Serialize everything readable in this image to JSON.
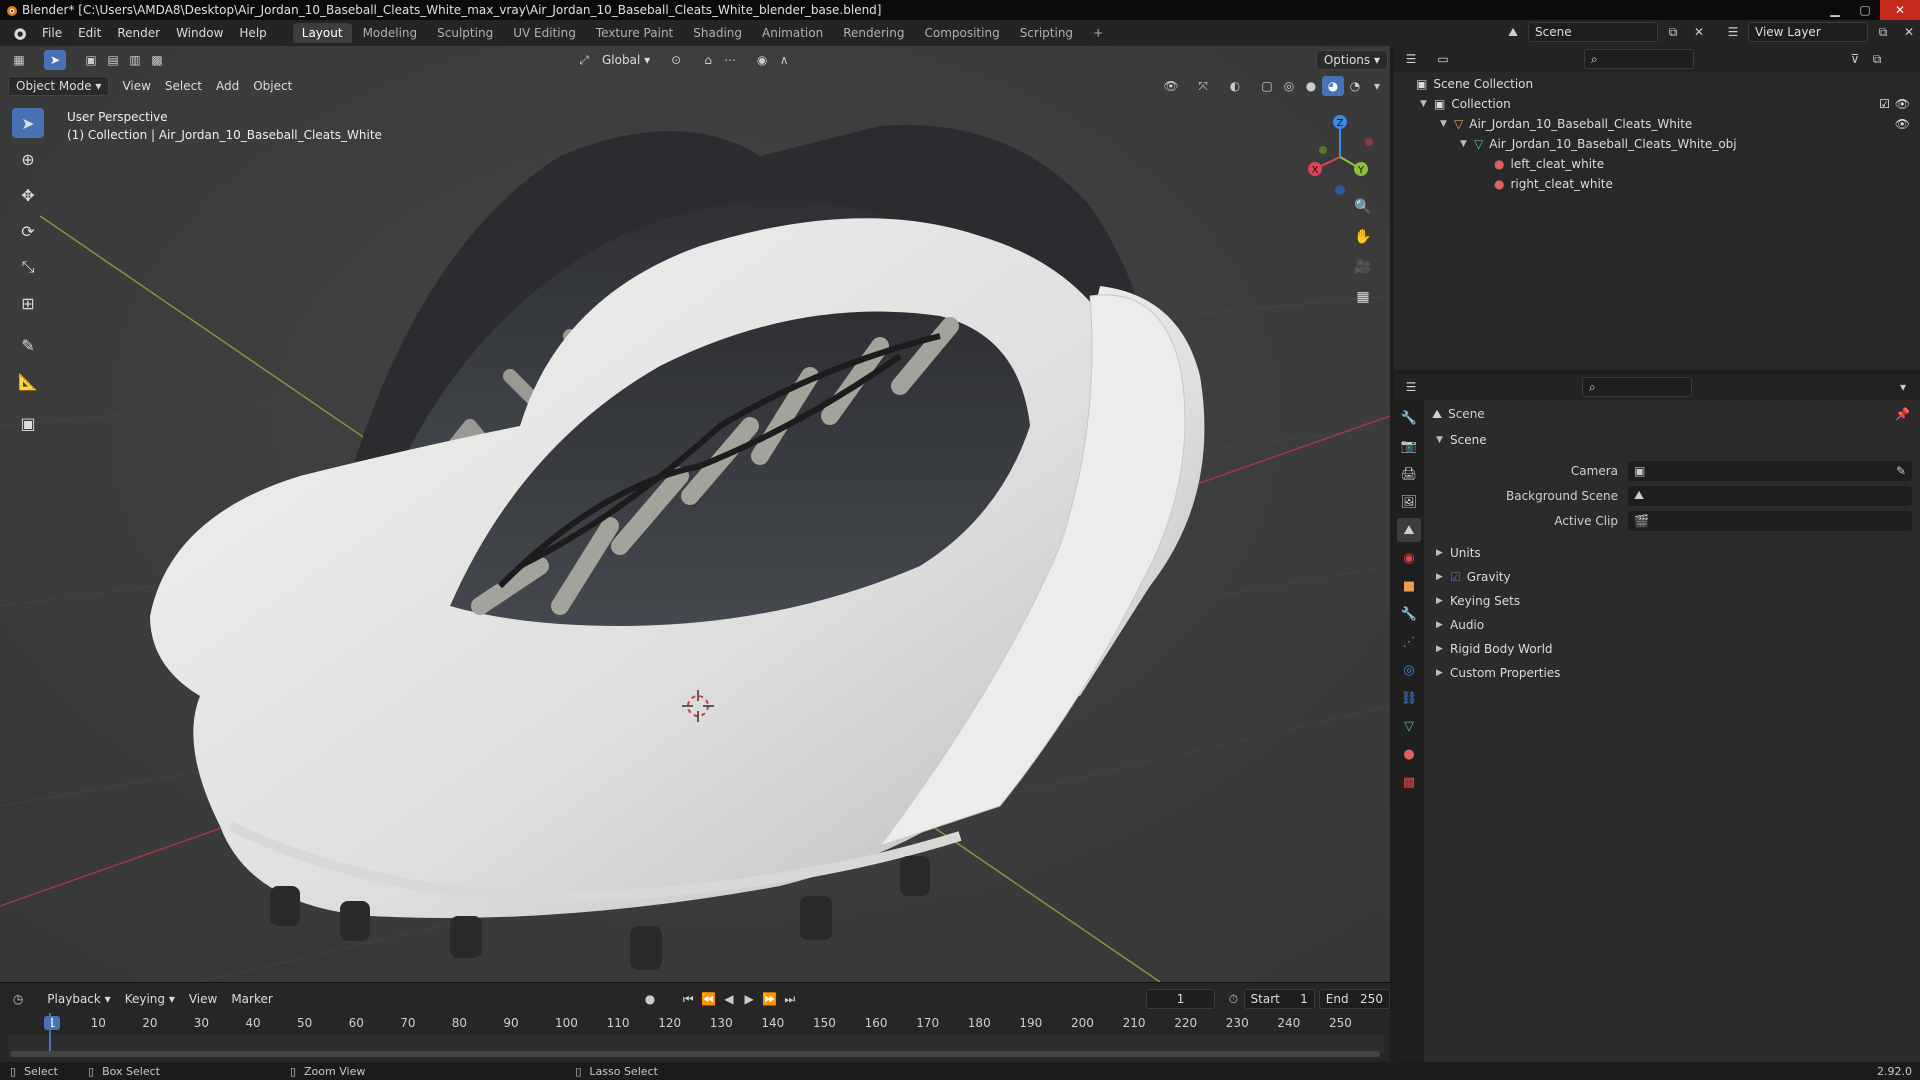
{
  "window": {
    "title": "Blender* [C:\\Users\\AMDA8\\Desktop\\Air_Jordan_10_Baseball_Cleats_White_max_vray\\Air_Jordan_10_Baseball_Cleats_White_blender_base.blend]"
  },
  "menu": [
    "File",
    "Edit",
    "Render",
    "Window",
    "Help"
  ],
  "workspaces": [
    "Layout",
    "Modeling",
    "Sculpting",
    "UV Editing",
    "Texture Paint",
    "Shading",
    "Animation",
    "Rendering",
    "Compositing",
    "Scripting"
  ],
  "active_workspace": "Layout",
  "topright": {
    "scene": "Scene",
    "view_layer": "View Layer"
  },
  "viewport": {
    "transform_orientation": "Global",
    "options_label": "Options",
    "mode": "Object Mode",
    "menus": [
      "View",
      "Select",
      "Add",
      "Object"
    ],
    "info_line1": "User Perspective",
    "info_line2": "(1) Collection | Air_Jordan_10_Baseball_Cleats_White"
  },
  "gizmo": {
    "x": "X",
    "y": "Y",
    "z": "Z"
  },
  "timeline": {
    "menus": [
      "Playback",
      "Keying",
      "View",
      "Marker"
    ],
    "current_frame": "1",
    "start_label": "Start",
    "start": "1",
    "end_label": "End",
    "end": "250",
    "ticks": [
      "1",
      "10",
      "20",
      "30",
      "40",
      "50",
      "60",
      "70",
      "80",
      "90",
      "100",
      "110",
      "120",
      "130",
      "140",
      "150",
      "160",
      "170",
      "180",
      "190",
      "200",
      "210",
      "220",
      "230",
      "240",
      "250"
    ]
  },
  "statusbar": {
    "select": "Select",
    "box_select": "Box Select",
    "zoom_view": "Zoom View",
    "lasso_select": "Lasso Select",
    "version": "2.92.0"
  },
  "outliner": {
    "scene_collection": "Scene Collection",
    "collection": "Collection",
    "object": "Air_Jordan_10_Baseball_Cleats_White",
    "mesh": "Air_Jordan_10_Baseball_Cleats_White_obj",
    "materials": [
      "left_cleat_white",
      "right_cleat_white"
    ]
  },
  "properties": {
    "header": "Scene",
    "section": "Scene",
    "fields": [
      {
        "label": "Camera",
        "value": ""
      },
      {
        "label": "Background Scene",
        "value": ""
      },
      {
        "label": "Active Clip",
        "value": ""
      }
    ],
    "subsections": [
      "Units",
      "Gravity",
      "Keying Sets",
      "Audio",
      "Rigid Body World",
      "Custom Properties"
    ]
  },
  "colors": {
    "accent": "#4772b3",
    "axis_x": "#e04455",
    "axis_y": "#8ac33a",
    "axis_z": "#3d8ae5"
  }
}
